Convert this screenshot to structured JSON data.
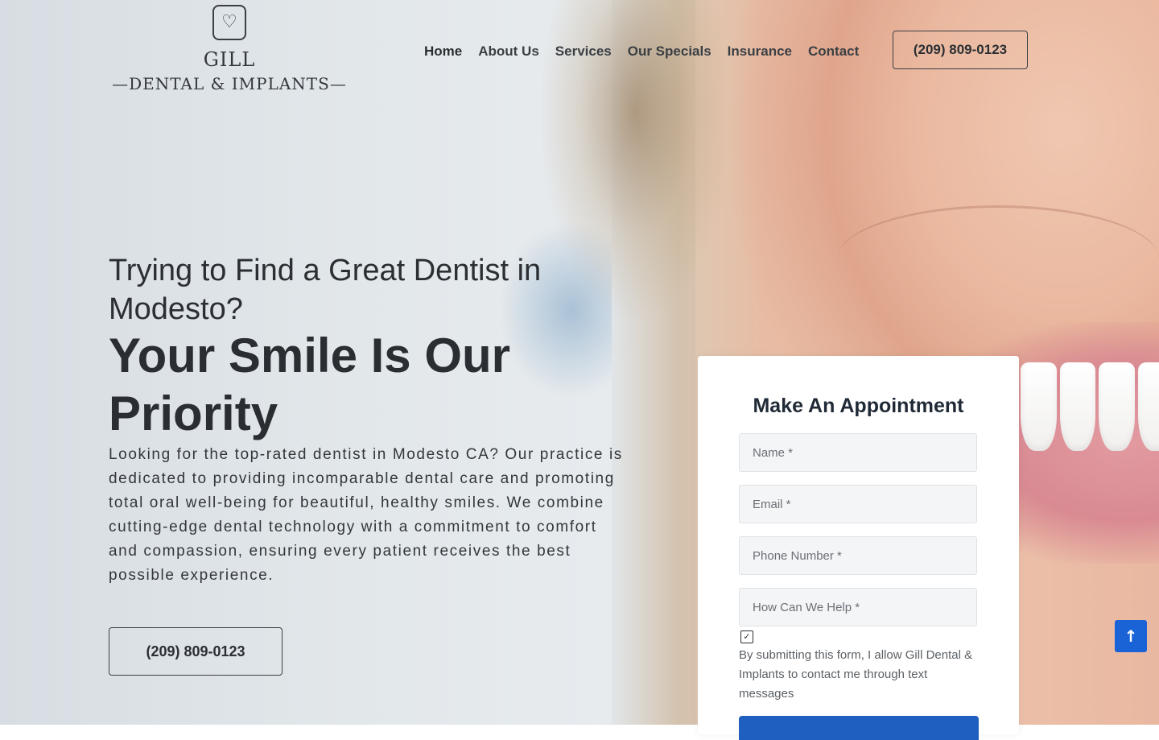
{
  "logo": {
    "mark_icon": "tooth-heart-icon",
    "line1": "GILL",
    "line2": "—DENTAL & IMPLANTS—"
  },
  "nav": {
    "items": [
      {
        "label": "Home"
      },
      {
        "label": "About Us"
      },
      {
        "label": "Services"
      },
      {
        "label": "Our Specials"
      },
      {
        "label": "Insurance"
      },
      {
        "label": "Contact"
      }
    ]
  },
  "header": {
    "phone": "(209) 809-0123"
  },
  "hero": {
    "subtitle": "Trying to Find a Great Dentist in Modesto?",
    "title": "Your Smile Is Our Priority",
    "description": "Looking for the top-rated dentist in Modesto CA? Our practice is dedicated to providing incomparable dental care and promoting total oral well-being for beautiful, healthy smiles. We combine cutting-edge dental technology with a commitment to comfort and compassion, ensuring every patient receives the best possible experience.",
    "phone": "(209) 809-0123"
  },
  "form": {
    "title": "Make An Appointment",
    "fields": {
      "name_placeholder": "Name *",
      "email_placeholder": "Email *",
      "phone_placeholder": "Phone Number *",
      "help_placeholder": "How Can We Help *"
    },
    "consent_text": "By submitting this form, I allow Gill Dental & Implants to contact me through text messages",
    "consent_checked": true
  },
  "colors": {
    "accent_blue": "#1a63d6",
    "text_dark": "#2b2f33"
  }
}
